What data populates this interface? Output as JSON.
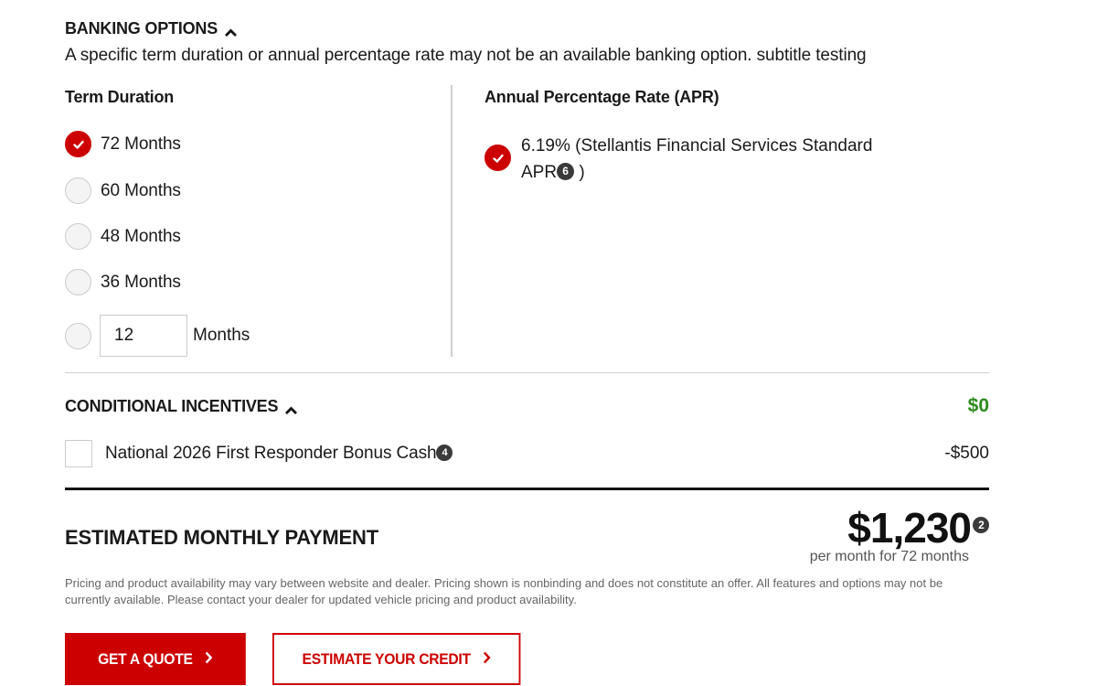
{
  "banking": {
    "title": "BANKING OPTIONS",
    "subtitle": "A specific term duration or annual percentage rate may not be an available banking option. subtitle testing",
    "term_title": "Term Duration",
    "apr_title": "Annual Percentage Rate (APR)",
    "terms": [
      {
        "label": "72 Months",
        "checked": true
      },
      {
        "label": "60 Months",
        "checked": false
      },
      {
        "label": "48 Months",
        "checked": false
      },
      {
        "label": "36 Months",
        "checked": false
      }
    ],
    "custom_term": {
      "value": "12",
      "suffix": "Months"
    },
    "apr_option": {
      "text": "6.19% (Stellantis Financial Services Standard APR",
      "badge": "6",
      "close": " )"
    }
  },
  "incentives": {
    "title": "CONDITIONAL INCENTIVES",
    "total": "$0",
    "items": [
      {
        "label": "National 2026 First Responder Bonus Cash",
        "badge": "4",
        "amount": "-$500"
      }
    ]
  },
  "estimate": {
    "title": "ESTIMATED MONTHLY PAYMENT",
    "amount": "$1,230",
    "badge": "2",
    "sub": "per month for 72 months",
    "disclaimer": "Pricing and product availability may vary between website and dealer. Pricing shown is nonbinding and does not constitute an offer. All features and options may not be currently available. Please contact your dealer for updated vehicle pricing and product availability."
  },
  "buttons": {
    "quote": "GET A QUOTE",
    "credit": "ESTIMATE YOUR CREDIT"
  },
  "colors": {
    "accent": "#cc0000",
    "positive": "#2e8b1e"
  },
  "icons": {
    "collapse": "chevron-up-icon",
    "check": "checkmark-icon",
    "next": "chevron-right-icon"
  }
}
